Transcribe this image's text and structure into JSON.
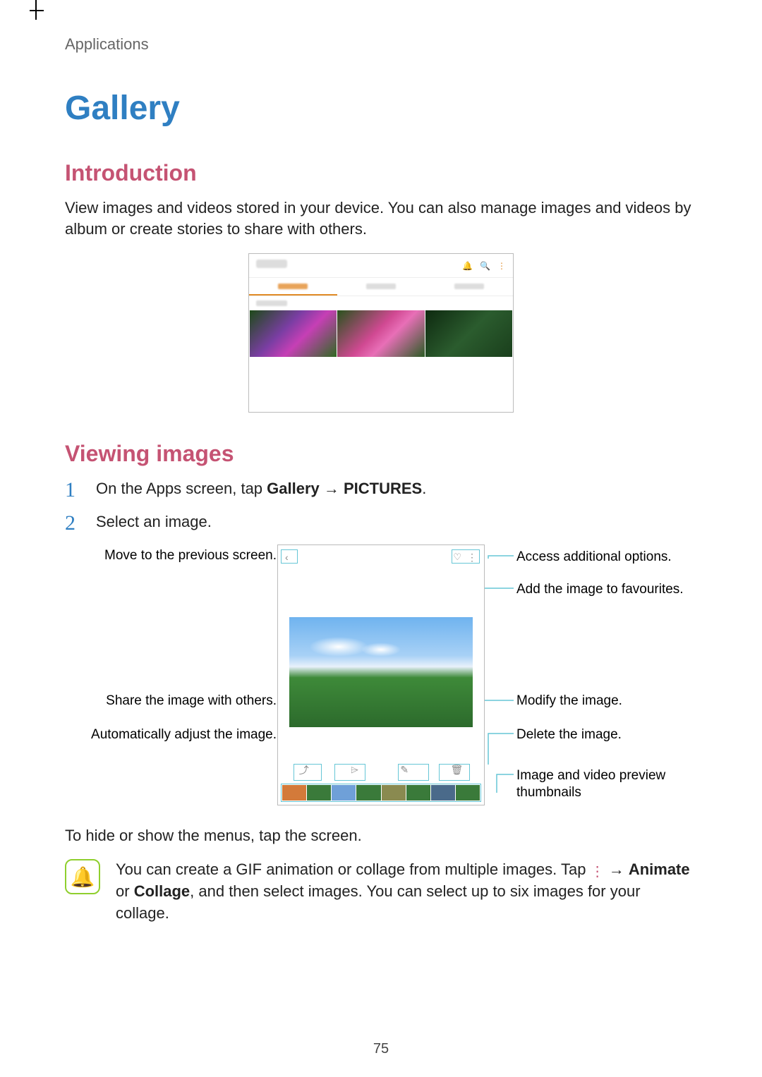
{
  "breadcrumb": "Applications",
  "title": "Gallery",
  "intro": {
    "heading": "Introduction",
    "body": "View images and videos stored in your device. You can also manage images and videos by album or create stories to share with others."
  },
  "viewing": {
    "heading": "Viewing images",
    "steps": [
      {
        "num": "1",
        "pre": "On the Apps screen, tap ",
        "bold1": "Gallery",
        "mid": " → ",
        "bold2": "PICTURES",
        "post": "."
      },
      {
        "num": "2",
        "pre": "Select an image.",
        "bold1": "",
        "mid": "",
        "bold2": "",
        "post": ""
      }
    ],
    "callouts": {
      "back": "Move to the previous screen.",
      "options": "Access additional options.",
      "favourite": "Add the image to favourites.",
      "share": "Share the image with others.",
      "auto": "Automatically adjust the image.",
      "modify": "Modify the image.",
      "delete": "Delete the image.",
      "thumbs": "Image and video preview thumbnails"
    },
    "hideShow": "To hide or show the menus, tap the screen."
  },
  "note": {
    "pre": "You can create a GIF animation or collage from multiple images. Tap ",
    "moreGlyph": "⋮",
    "mid": " → ",
    "bold1": "Animate",
    "join": " or ",
    "bold2": "Collage",
    "post": ", and then select images. You can select up to six images for your collage."
  },
  "icons": {
    "bell": "🔔",
    "search": "🔍",
    "more": "⋮",
    "back": "‹",
    "heart": "♡",
    "share": "⤴",
    "send": "⌲",
    "edit": "✎",
    "trash": "🗑",
    "notify": "🔔"
  },
  "pageNumber": "75"
}
